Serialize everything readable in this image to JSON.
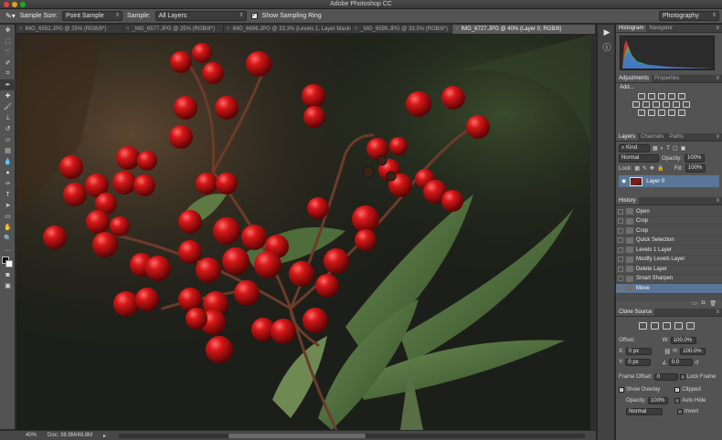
{
  "window": {
    "title": "Adobe Photoshop CC"
  },
  "options_bar": {
    "sample_size_label": "Sample Size:",
    "sample_size_value": "Point Sample",
    "sample_label": "Sample:",
    "sample_value": "All Layers",
    "show_sampling_ring_label": "Show Sampling Ring",
    "show_sampling_ring_checked": true,
    "workspace_value": "Photography"
  },
  "doc_tabs": [
    {
      "label": "IMG_6552.JPG @ 25% (RGB/8*)",
      "active": false
    },
    {
      "label": "_MG_6577.JPG @ 25% (RGB/8*)",
      "active": false
    },
    {
      "label": "IMG_6696.JPG @ 33.3% (Levels 1, Layer Mask/8)",
      "active": false
    },
    {
      "label": "_MG_6599.JPG @ 33.3% (RGB/8*)",
      "active": false
    },
    {
      "label": "IMG_6727.JPG @ 40% (Layer 0, RGB/8)",
      "active": true
    }
  ],
  "status": {
    "zoom": "40%",
    "doc": "Doc: 38.9M/48.8M"
  },
  "histogram_panel": {
    "tabs": [
      "Histogram",
      "Navigator"
    ]
  },
  "adjustments_panel": {
    "tabs": [
      "Adjustments",
      "Properties"
    ],
    "add_label": "Add..."
  },
  "layers_panel": {
    "tabs": [
      "Layers",
      "Channels",
      "Paths"
    ],
    "filter_value": "Kind",
    "blend_mode": "Normal",
    "opacity_label": "Opacity:",
    "opacity_value": "100%",
    "lock_label": "Lock:",
    "fill_label": "Fill:",
    "fill_value": "100%",
    "layers": [
      {
        "name": "Layer 0",
        "selected": true
      }
    ]
  },
  "history_panel": {
    "tab": "History",
    "items": [
      {
        "label": "Open",
        "selected": false
      },
      {
        "label": "Crop",
        "selected": false
      },
      {
        "label": "Crop",
        "selected": false
      },
      {
        "label": "Quick Selection",
        "selected": false
      },
      {
        "label": "Levels 1 Layer",
        "selected": false
      },
      {
        "label": "Modify Levels Layer",
        "selected": false
      },
      {
        "label": "Delete Layer",
        "selected": false
      },
      {
        "label": "Smart Sharpen",
        "selected": false
      },
      {
        "label": "Move",
        "selected": true
      }
    ]
  },
  "clone_source_panel": {
    "tab": "Clone Source",
    "offset_label": "Offset:",
    "x_label": "X:",
    "x_value": "0 px",
    "y_label": "Y:",
    "y_value": "0 px",
    "w_label": "W:",
    "w_value": "100.0%",
    "h_label": "H:",
    "h_value": "100.0%",
    "angle_value": "0.0",
    "frame_offset_label": "Frame Offset:",
    "frame_offset_value": "0",
    "lock_frame_label": "Lock Frame",
    "show_overlay_label": "Show Overlay",
    "clipped_label": "Clipped",
    "overlay_opacity_label": "Opacity:",
    "overlay_opacity_value": "100%",
    "auto_hide_label": "Auto Hide",
    "overlay_mode": "Normal",
    "invert_label": "Invert"
  }
}
